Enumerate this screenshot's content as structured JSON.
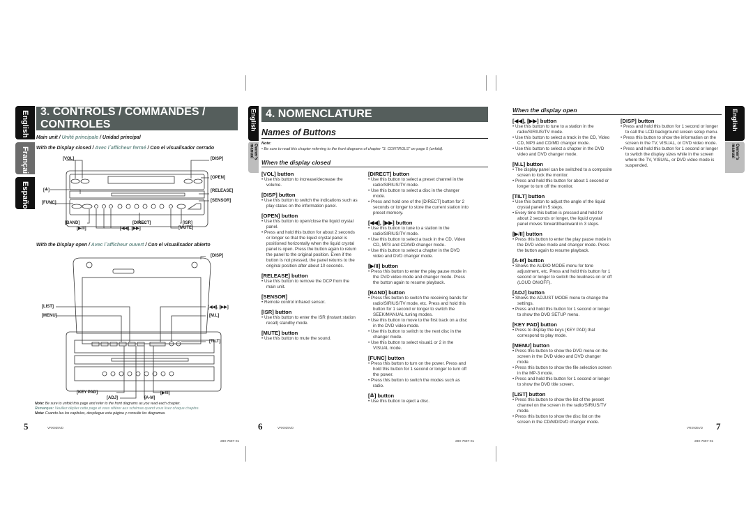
{
  "page5": {
    "tabs": [
      "English",
      "Français",
      "Español"
    ],
    "title": "3. CONTROLS / COMMANDES / CONTROLES",
    "main_unit": {
      "en": "Main unit",
      "fr": "Unité principale",
      "es": "Unidad principal"
    },
    "closed": {
      "en": "With the Display closed",
      "fr": "Avec l´afficheur fermé",
      "es": "Con el visualisador cerrado"
    },
    "closed_labels": {
      "vol": "[VOL]",
      "disp": "[DISP]",
      "open": "[OPEN]",
      "eject": "[≜]",
      "release": "[RELEASE]",
      "func": "[FUNC]",
      "sensor": "[SENSOR]",
      "band": "[BAND]",
      "direct": "[DIRECT]",
      "isr": "[ISR]",
      "play": "[▶/II]",
      "skip": "[◀◀], [▶▶]",
      "mute": "[MUTE]"
    },
    "open": {
      "en": "With the Display open",
      "fr": "Avec l´afficheur ouvert",
      "es": "Con el visualisador abierto"
    },
    "open_labels": {
      "disp": "[DISP]",
      "list": "[LIST]",
      "menu": "[MENU]",
      "skip": "[◀◀], [▶▶]",
      "ml": "[M.L]",
      "tilt": "[TILT]",
      "keypad": "[KEY PAD]",
      "adj": "[ADJ]",
      "am": "[A-M]",
      "play": "[▶/II]"
    },
    "notes": {
      "en_label": "Note:",
      "en": "Be sure to unfold this page and refer to the front diagrams as you read each chapter.",
      "fr_label": "Remarque:",
      "fr": "Veuillez déplier cette page et vous référer aux schémas quand vous lisez chaque chapitre.",
      "es_label": "Nota:",
      "es": "Cuando lea los capítulos, despliegue esta página y consulte los diagramas."
    },
    "page_number": "5",
    "model": "VRX935VD",
    "code": "280-7697-01"
  },
  "page6": {
    "tab": "English",
    "tab_sub": "Owner's manual",
    "title": "4. NOMENCLATURE",
    "heading": "Names of Buttons",
    "note_label": "Note:",
    "note": "• Be sure to read this chapter referring to the front diagrams of chapter \"3. CONTROLS\" on page 5 (unfold).",
    "section": "When the display closed",
    "left": [
      {
        "title": "[VOL] button",
        "items": [
          "Use this button to increase/decrease the volume."
        ]
      },
      {
        "title": "[DISP] button",
        "items": [
          "Use this button to switch the indications such as play status on the information panel."
        ]
      },
      {
        "title": "[OPEN] button",
        "items": [
          "Use this button to open/close the liquid crystal panel.",
          "Press and hold this button for about 2 seconds or longer so that the liquid crystal panel is positioned horizontally when the liquid crystal panel is open. Press the button again to return the panel to the original position. Even if the button is not pressed, the panel returns to the original position after about 10 seconds."
        ]
      },
      {
        "title": "[RELEASE] button",
        "items": [
          "Use this button to remove the DCP from the main unit."
        ]
      },
      {
        "title": "[SENSOR]",
        "items": [
          "Remote control infrared sensor."
        ]
      },
      {
        "title": "[ISR] button",
        "items": [
          "Use this button to enter the ISR (Instant station recall) standby mode."
        ]
      },
      {
        "title": "[MUTE] button",
        "items": [
          "Use this button to mute the sound."
        ]
      }
    ],
    "right": [
      {
        "title": "[DIRECT] button",
        "items": [
          "Use this button to select a preset channel in the radio/SIRIUS/TV mode.",
          "Use this button to select a disc in the changer mode.",
          "Press and hold one of the [DIRECT] button for 2 seconds or longer to store the current station into preset memory."
        ]
      },
      {
        "title": "[◀◀], [▶▶] button",
        "items": [
          "Use this button to tune to a station in the radio/SIRIUS/TV mode.",
          "Use this button to select a track in the CD, Video CD, MP3 and CD/MD changer mode.",
          "Use this button to select a chapter in the DVD video and DVD changer mode."
        ]
      },
      {
        "title": "[▶/II] button",
        "items": [
          "Press this button to enter the play pause mode in the DVD video mode and changer mode. Press the button again to resume playback."
        ]
      },
      {
        "title": "[BAND] button",
        "items": [
          "Press this button to switch the receiving bands for radio/SIRIUS/TV mode, etc. Press and hold this button for 1 second or longer to switch the SEEK/MANUAL tuning modes.",
          "Use this button to move to the first track on a disc in the DVD video mode.",
          "Use this button to switch to the next disc in the changer mode.",
          "Use this button to select visual1 or 2 in the VISUAL mode."
        ]
      },
      {
        "title": "[FUNC] button",
        "items": [
          "Press this button to turn on the power. Press and hold this button for 1 second or longer to turn off the power.",
          "Press this button to switch the modes such as radio."
        ]
      },
      {
        "title": "[≜] button",
        "items": [
          "Use this button to eject a disc."
        ]
      }
    ],
    "page_number": "6",
    "model": "VRX935VD",
    "code": "280-7697-01"
  },
  "page7": {
    "tab": "English",
    "tab_sub": "Owner's manual",
    "section": "When the display open",
    "left": [
      {
        "title": "[◀◀], [▶▶] button",
        "items": [
          "Use this button to tune to a station in the radio/SIRIUS/TV mode.",
          "Use this button to select a track in the CD, Video CD, MP3 and CD/MD changer mode.",
          "Use this button to select a chapter in the DVD video and DVD changer mode."
        ]
      },
      {
        "title": "[M.L] button",
        "items": [
          "The display panel can be switched to a composite screen to lock the monitor.",
          "Press and hold this button for about 1 second or longer to turn off the monitor."
        ]
      },
      {
        "title": "[TILT] button",
        "items": [
          "Use this button to adjust the angle of the liquid crystal panel in 5 steps.",
          "Every time this button is pressed and held for about 2 seconds or longer, the liquid crystal panel moves forward/backward in 3 steps."
        ]
      },
      {
        "title": "[▶/II] button",
        "items": [
          "Press this button to enter the play pause mode in the DVD video mode and changer mode. Press the button again to resume playback."
        ]
      },
      {
        "title": "[A-M] button",
        "items": [
          "Shows the AUDIO MODE menu for tone adjustment, etc. Press and hold this button for 1 second or longer to switch the loudness on or off (LOUD ON/OFF)."
        ]
      },
      {
        "title": "[ADJ] button",
        "items": [
          "Shows the ADJUST MODE menu to change the settings.",
          "Press and hold this button for 1 second or longer to show the DVD SETUP menu."
        ]
      },
      {
        "title": "[KEY PAD] button",
        "items": [
          "Press to display the keys (KEY PAD) that correspond to play mode."
        ]
      },
      {
        "title": "[MENU] button",
        "items": [
          "Press this button to show the DVD menu on the screen in the DVD video and DVD changer mode.",
          "Press this button to show the file selection screen in the MP-3 mode.",
          "Press and hold this button for 1 second or longer to show the DVD title screen."
        ]
      },
      {
        "title": "[LIST] button",
        "items": [
          "Press this button to show the list of the preset channel on the screen in the radio/SIRIUS/TV mode.",
          "Press this button to show the disc list on the screen in the CD/MD/DVD changer mode."
        ]
      }
    ],
    "right": [
      {
        "title": "[DISP] button",
        "items": [
          "Press and hold this button for 1 second or longer to call the LCD background screen setup menu.",
          "Press this button to show the information on the screen in the TV, VISUAL, or DVD video mode.",
          "Press and hold this button for 1 second or longer to switch the display sizes while in the screen where the TV, VISUAL, or DVD video mode is suspended."
        ]
      }
    ],
    "page_number": "7",
    "model": "VRX935VD",
    "code": "280-7697-01"
  },
  "colors": {
    "header_bar": "#555e5c",
    "tab_black": "#111111",
    "tab_gray": "#6b6b6b",
    "french_text": "#6b8f8a"
  }
}
